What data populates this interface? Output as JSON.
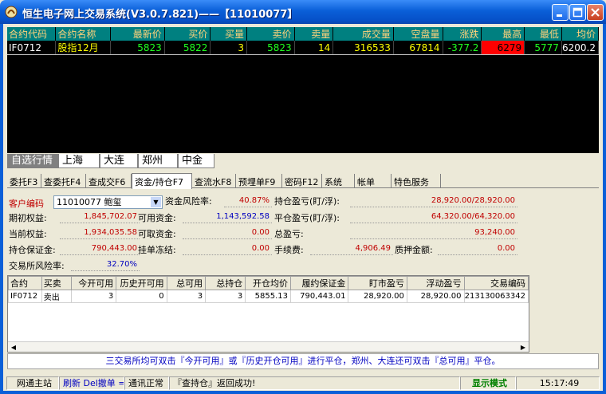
{
  "window": {
    "title": "恒生电子网上交易系统(V3.0.7.821)——【11010077】",
    "icons": [
      "app-logo-icon",
      "minimize-icon",
      "maximize-icon",
      "close-icon"
    ]
  },
  "quote": {
    "headers": [
      "合约代码",
      "合约名称",
      "最新价",
      "买价",
      "买量",
      "卖价",
      "卖量",
      "成交量",
      "空盘量",
      "涨跌",
      "最高",
      "最低",
      "均价"
    ],
    "row": {
      "code": "IF0712",
      "name": "股指12月",
      "last": "5823",
      "bid": "5822",
      "bid_vol": "3",
      "ask": "5823",
      "ask_vol": "14",
      "volume": "316533",
      "open_interest": "67814",
      "change": "-377.2",
      "high": "6279",
      "low": "5777",
      "avg": "6200.2"
    },
    "colors": {
      "header_bg": "#008080",
      "header_text": "#ffd27a"
    }
  },
  "market_tabs": [
    "自选行情",
    "上海",
    "大连",
    "郑州",
    "中金"
  ],
  "trade_tabs": [
    "委托F3",
    "查委托F4",
    "查成交F6",
    "资金/持仓F7",
    "查流水F8",
    "预埋单F9",
    "密码F12",
    "系统",
    "帐单",
    "特色服务"
  ],
  "account": {
    "customer_label": "客户编码",
    "customer_value": "11010077 鲍玺",
    "fund_risk_label": "资金风险率:",
    "fund_risk": "40.87%",
    "pos_pl_label": "持仓盈亏(盯/浮):",
    "pos_pl": "28,920.00/28,920.00",
    "opening_equity_label": "期初权益:",
    "opening_equity": "1,845,702.07",
    "available_label": "可用资金:",
    "available": "1,143,592.58",
    "close_pl_label": "平仓盈亏(盯/浮):",
    "close_pl": "64,320.00/64,320.00",
    "current_equity_label": "当前权益:",
    "current_equity": "1,934,035.58",
    "withdrawable_label": "可取资金:",
    "withdrawable": "0.00",
    "total_pl_label": "总盈亏:",
    "total_pl": "93,240.00",
    "margin_label": "持仓保证金:",
    "margin": "790,443.00",
    "frozen_label": "挂单冻结:",
    "frozen": "0.00",
    "fee_label": "手续费:",
    "fee": "4,906.49",
    "pledge_label": "质押金额:",
    "pledge": "0.00",
    "exch_risk_label": "交易所风险率:",
    "exch_risk": "32.70%"
  },
  "positions": {
    "headers": [
      "合约",
      "买卖",
      "今开可用",
      "历史开可用",
      "总可用",
      "总持仓",
      "开仓均价",
      "履约保证金",
      "盯市盈亏",
      "浮动盈亏",
      "交易编码"
    ],
    "rows": [
      [
        "IF0712",
        "卖出",
        "3",
        "0",
        "3",
        "3",
        "5855.13",
        "790,443.01",
        "28,920.00",
        "28,920.00",
        "213130063342"
      ]
    ]
  },
  "hint": "三交易所均可双击『今开可用』或『历史开仓可用』进行平仓，郑州、大连还可双击『总可用』平仓。",
  "status": {
    "station": "网通主站",
    "refresh": "刷新 Del撤单 =",
    "comm": "通讯正常",
    "message": "『查持仓』返回成功!",
    "mode": "显示模式",
    "time": "15:17:49"
  }
}
